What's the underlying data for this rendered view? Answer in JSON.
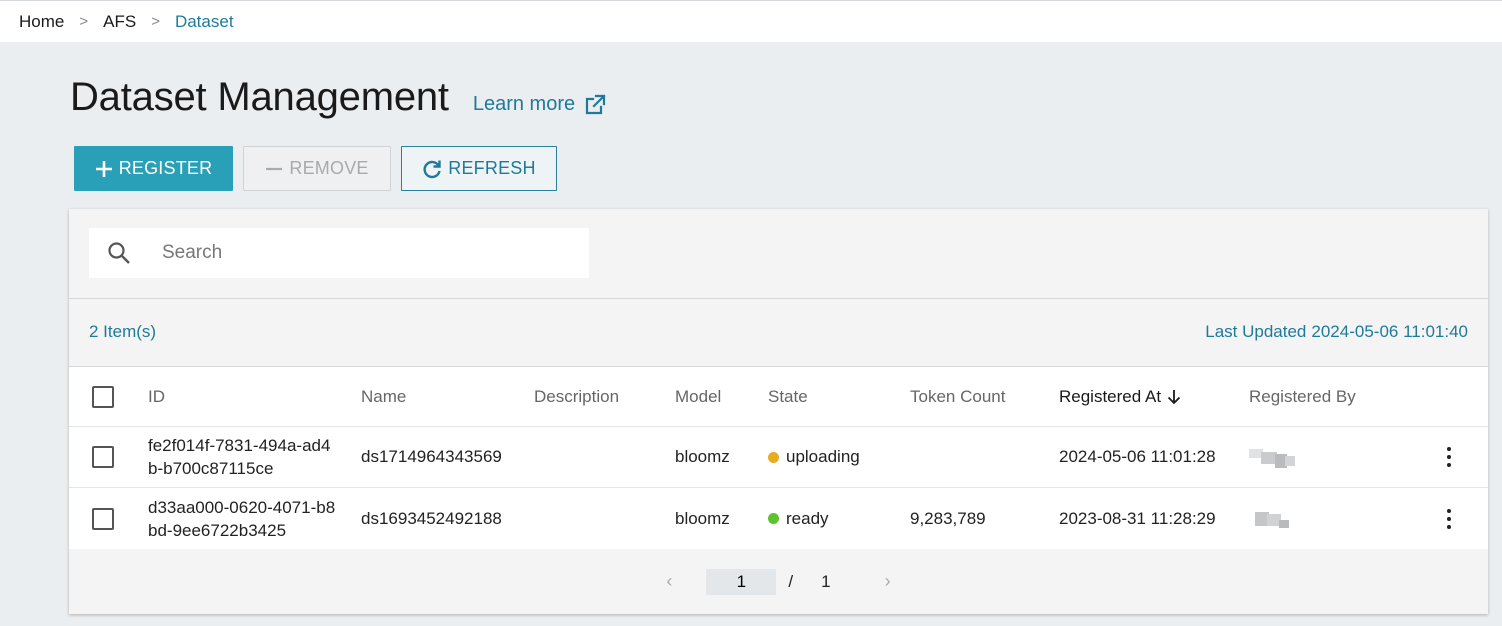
{
  "breadcrumb": [
    {
      "label": "Home"
    },
    {
      "label": "AFS"
    },
    {
      "label": "Dataset"
    }
  ],
  "breadcrumb_separator": ">",
  "page": {
    "title": "Dataset Management",
    "learn_more": "Learn more"
  },
  "toolbar": {
    "register_label": "REGISTER",
    "remove_label": "REMOVE",
    "refresh_label": "REFRESH"
  },
  "search": {
    "placeholder": "Search",
    "value": ""
  },
  "summary": {
    "items_count": "2 Item(s)",
    "last_updated_label": "Last Updated",
    "last_updated_value": "2024-05-06 11:01:40"
  },
  "table": {
    "columns": {
      "id": "ID",
      "name": "Name",
      "description": "Description",
      "model": "Model",
      "state": "State",
      "token_count": "Token Count",
      "registered_at": "Registered At",
      "registered_by": "Registered By"
    },
    "sort_indicator": "↓",
    "rows": [
      {
        "id": "fe2f014f-7831-494a-ad4b-b700c87115ce",
        "name": "ds1714964343569",
        "description": "",
        "model": "bloomz",
        "state": "uploading",
        "state_color": "#e8ac1c",
        "token_count": "",
        "registered_at": "2024-05-06 11:01:28"
      },
      {
        "id": "d33aa000-0620-4071-b8bd-9ee6722b3425",
        "name": "ds1693452492188",
        "description": "",
        "model": "bloomz",
        "state": "ready",
        "state_color": "#5cc22e",
        "token_count": "9,283,789",
        "registered_at": "2023-08-31 11:28:29"
      }
    ]
  },
  "pagination": {
    "current_page": "1",
    "separator": "/",
    "total_pages": "1",
    "prev_glyph": "‹",
    "next_glyph": "›"
  },
  "colors": {
    "accent": "#1f7a9a",
    "primary_button": "#2aa0b8",
    "background": "#eaeef1"
  },
  "icons": {
    "learn_more": "external-link-icon",
    "register": "plus-icon",
    "remove": "minus-icon",
    "refresh": "refresh-icon",
    "search": "search-icon",
    "sort": "arrow-down-icon",
    "row_menu": "kebab-menu-icon"
  }
}
